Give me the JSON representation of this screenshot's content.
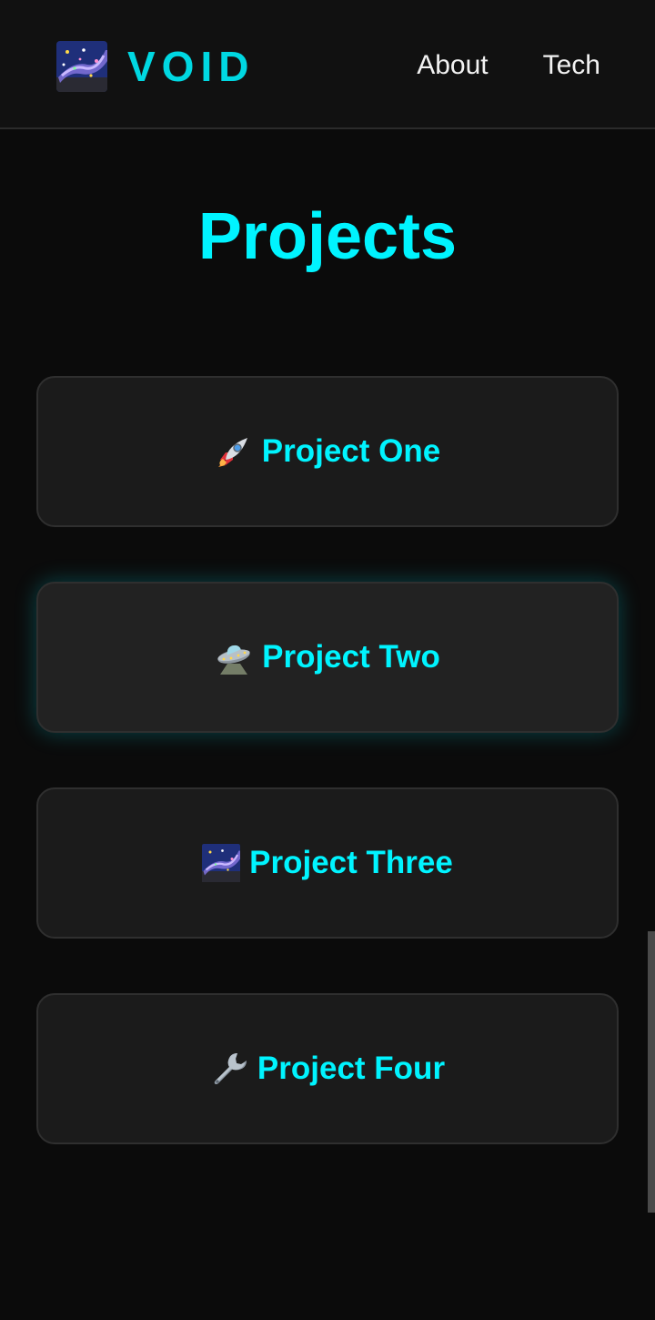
{
  "scroll_progress": 0.9,
  "header": {
    "logo_icon": "galaxy-icon",
    "brand": "VOID",
    "nav": [
      {
        "label": "About"
      },
      {
        "label": "Tech"
      }
    ]
  },
  "main": {
    "title": "Projects",
    "projects": [
      {
        "icon": "rocket-icon",
        "label": "Project One"
      },
      {
        "icon": "flying-saucer-icon",
        "label": "Project Two"
      },
      {
        "icon": "galaxy-icon",
        "label": "Project Three"
      },
      {
        "icon": "wrench-icon",
        "label": "Project Four"
      }
    ]
  },
  "colors": {
    "accent": "#00f4ff",
    "brand": "#00d8e2",
    "background": "#0b0b0b",
    "card": "#1b1b1b"
  }
}
